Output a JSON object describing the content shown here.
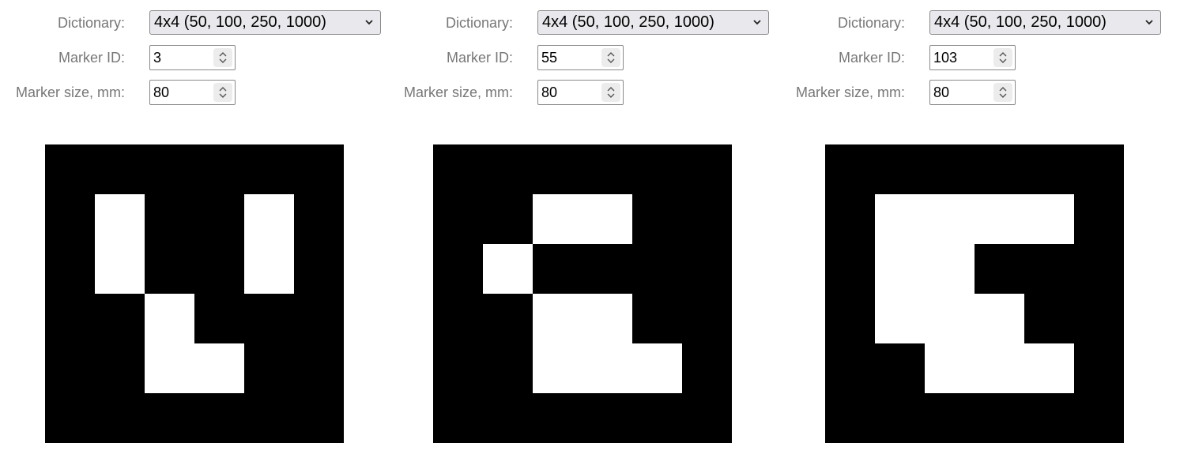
{
  "labels": {
    "dictionary": "Dictionary:",
    "marker_id": "Marker ID:",
    "marker_size": "Marker size, mm:"
  },
  "icons": {
    "dropdown": "chevron-down-icon",
    "spinner": "spinner-arrows-icon"
  },
  "colors": {
    "marker_black": "#000000",
    "marker_white": "#ffffff",
    "label_gray": "#777777"
  },
  "panels": [
    {
      "dictionary": "4x4 (50, 100, 250, 1000)",
      "marker_id": "3",
      "marker_size": "80",
      "bits": [
        [
          1,
          0,
          0,
          1
        ],
        [
          1,
          0,
          0,
          1
        ],
        [
          0,
          1,
          0,
          0
        ],
        [
          0,
          1,
          1,
          0
        ]
      ]
    },
    {
      "dictionary": "4x4 (50, 100, 250, 1000)",
      "marker_id": "55",
      "marker_size": "80",
      "bits": [
        [
          0,
          1,
          1,
          0
        ],
        [
          1,
          0,
          0,
          0
        ],
        [
          0,
          1,
          1,
          0
        ],
        [
          0,
          1,
          1,
          1
        ]
      ]
    },
    {
      "dictionary": "4x4 (50, 100, 250, 1000)",
      "marker_id": "103",
      "marker_size": "80",
      "bits": [
        [
          1,
          1,
          1,
          1
        ],
        [
          1,
          1,
          0,
          0
        ],
        [
          1,
          1,
          1,
          0
        ],
        [
          0,
          1,
          1,
          1
        ]
      ]
    }
  ]
}
